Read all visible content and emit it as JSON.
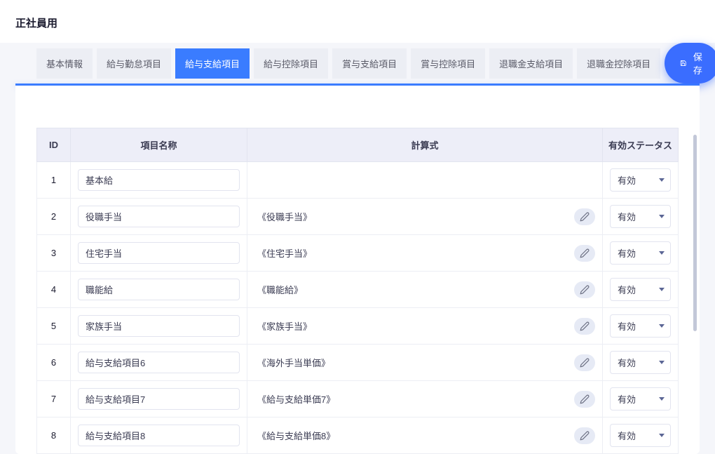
{
  "page_title": "正社員用",
  "tabs": [
    {
      "label": "基本情報"
    },
    {
      "label": "給与勤怠項目"
    },
    {
      "label": "給与支給項目",
      "active": true
    },
    {
      "label": "給与控除項目"
    },
    {
      "label": "賞与支給項目"
    },
    {
      "label": "賞与控除項目"
    },
    {
      "label": "退職金支給項目"
    },
    {
      "label": "退職金控除項目"
    }
  ],
  "save_label": "保存",
  "table": {
    "headers": {
      "id": "ID",
      "name": "項目名称",
      "formula": "計算式",
      "status": "有効ステータス"
    },
    "rows": [
      {
        "id": "1",
        "name": "基本給",
        "formula": "",
        "editable": false,
        "status": "有効"
      },
      {
        "id": "2",
        "name": "役職手当",
        "formula": "《役職手当》",
        "editable": true,
        "status": "有効"
      },
      {
        "id": "3",
        "name": "住宅手当",
        "formula": "《住宅手当》",
        "editable": true,
        "status": "有効"
      },
      {
        "id": "4",
        "name": "職能給",
        "formula": "《職能給》",
        "editable": true,
        "status": "有効"
      },
      {
        "id": "5",
        "name": "家族手当",
        "formula": "《家族手当》",
        "editable": true,
        "status": "有効"
      },
      {
        "id": "6",
        "name": "給与支給項目6",
        "formula": "《海外手当単価》",
        "editable": true,
        "status": "有効"
      },
      {
        "id": "7",
        "name": "給与支給項目7",
        "formula": "《給与支給単価7》",
        "editable": true,
        "status": "有効"
      },
      {
        "id": "8",
        "name": "給与支給項目8",
        "formula": "《給与支給単価8》",
        "editable": true,
        "status": "有効"
      }
    ]
  }
}
